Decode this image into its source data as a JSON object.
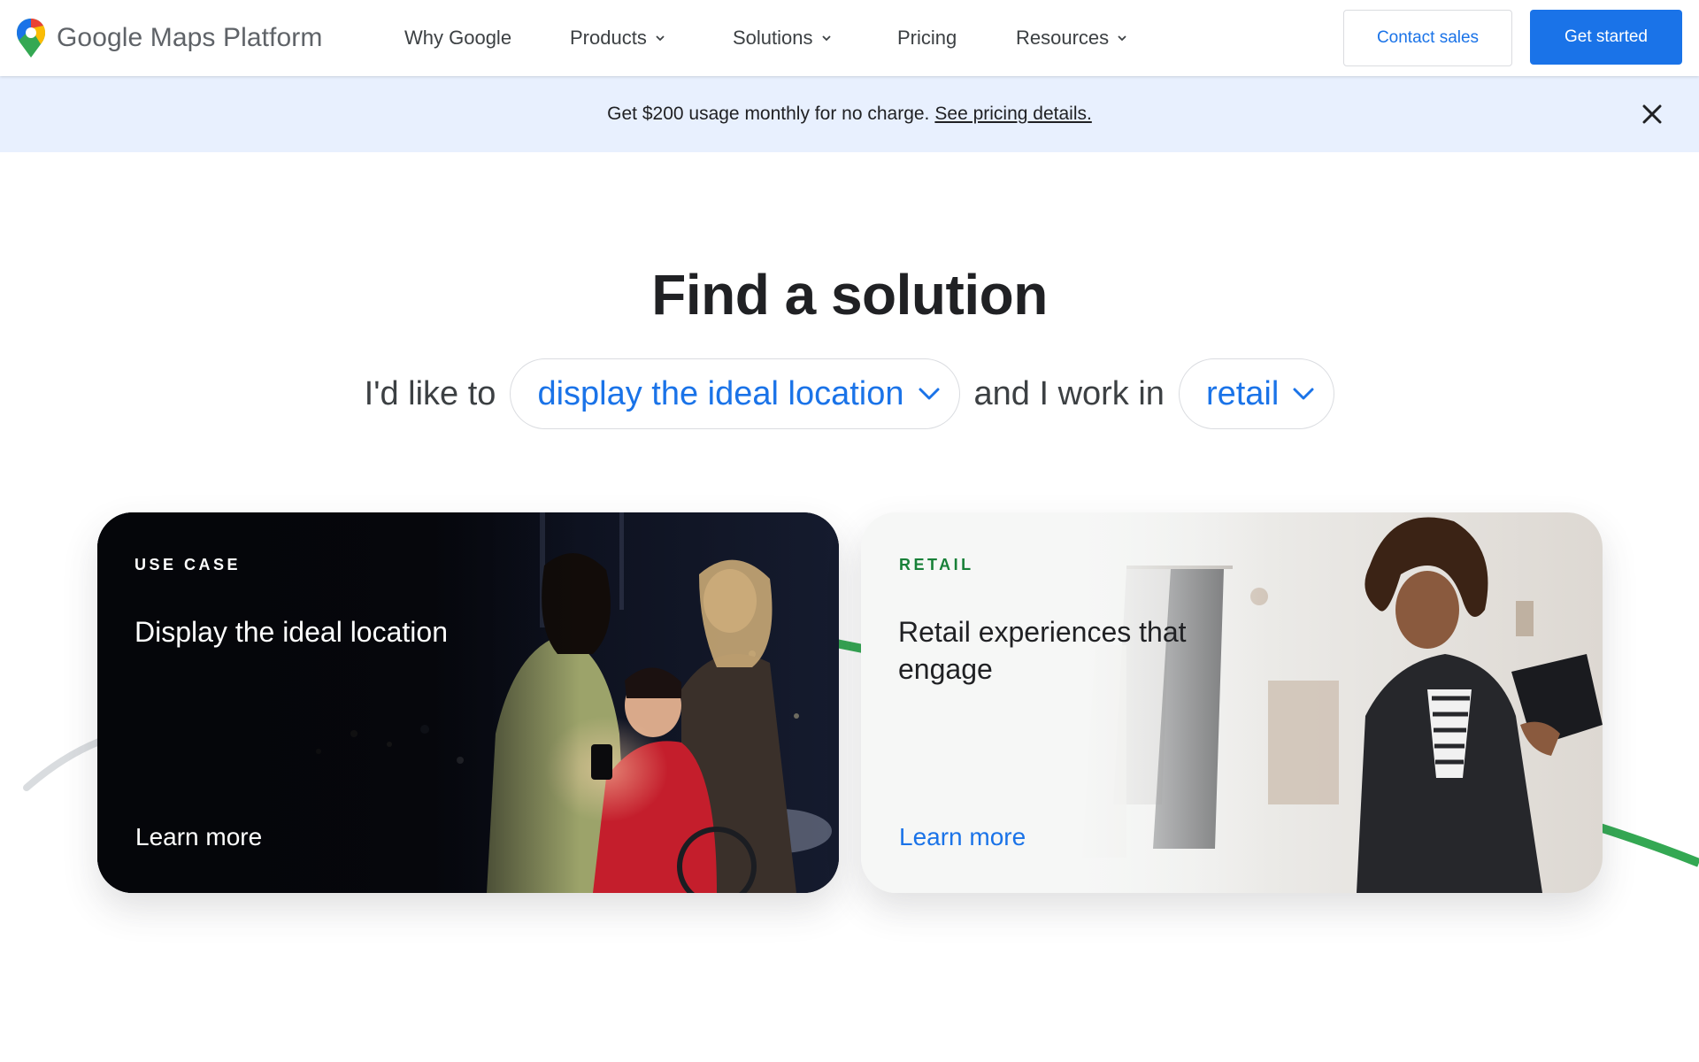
{
  "nav": {
    "brand": "Google Maps Platform",
    "items": [
      {
        "label": "Why Google"
      },
      {
        "label": "Products"
      },
      {
        "label": "Solutions"
      },
      {
        "label": "Pricing"
      },
      {
        "label": "Resources"
      }
    ],
    "contact_label": "Contact sales",
    "get_started_label": "Get started"
  },
  "promo": {
    "text": "Get $200 usage monthly for no charge.",
    "link": "See pricing details."
  },
  "finder": {
    "title": "Find a solution",
    "prefix": "I'd like to",
    "goal": "display the ideal location",
    "middle": "and I work in",
    "industry": "retail"
  },
  "cards": [
    {
      "eyebrow": "USE CASE",
      "heading": "Display the ideal location",
      "link": "Learn more"
    },
    {
      "eyebrow": "RETAIL",
      "heading": "Retail experiences that engage",
      "link": "Learn more"
    }
  ],
  "colors": {
    "accent": "#1a73e8",
    "banner": "#e8f0fe",
    "retail_green": "#188038",
    "text": "#202124"
  },
  "icons": [
    "maps-pin-logo-icon",
    "chevron-down-icon",
    "close-icon"
  ]
}
